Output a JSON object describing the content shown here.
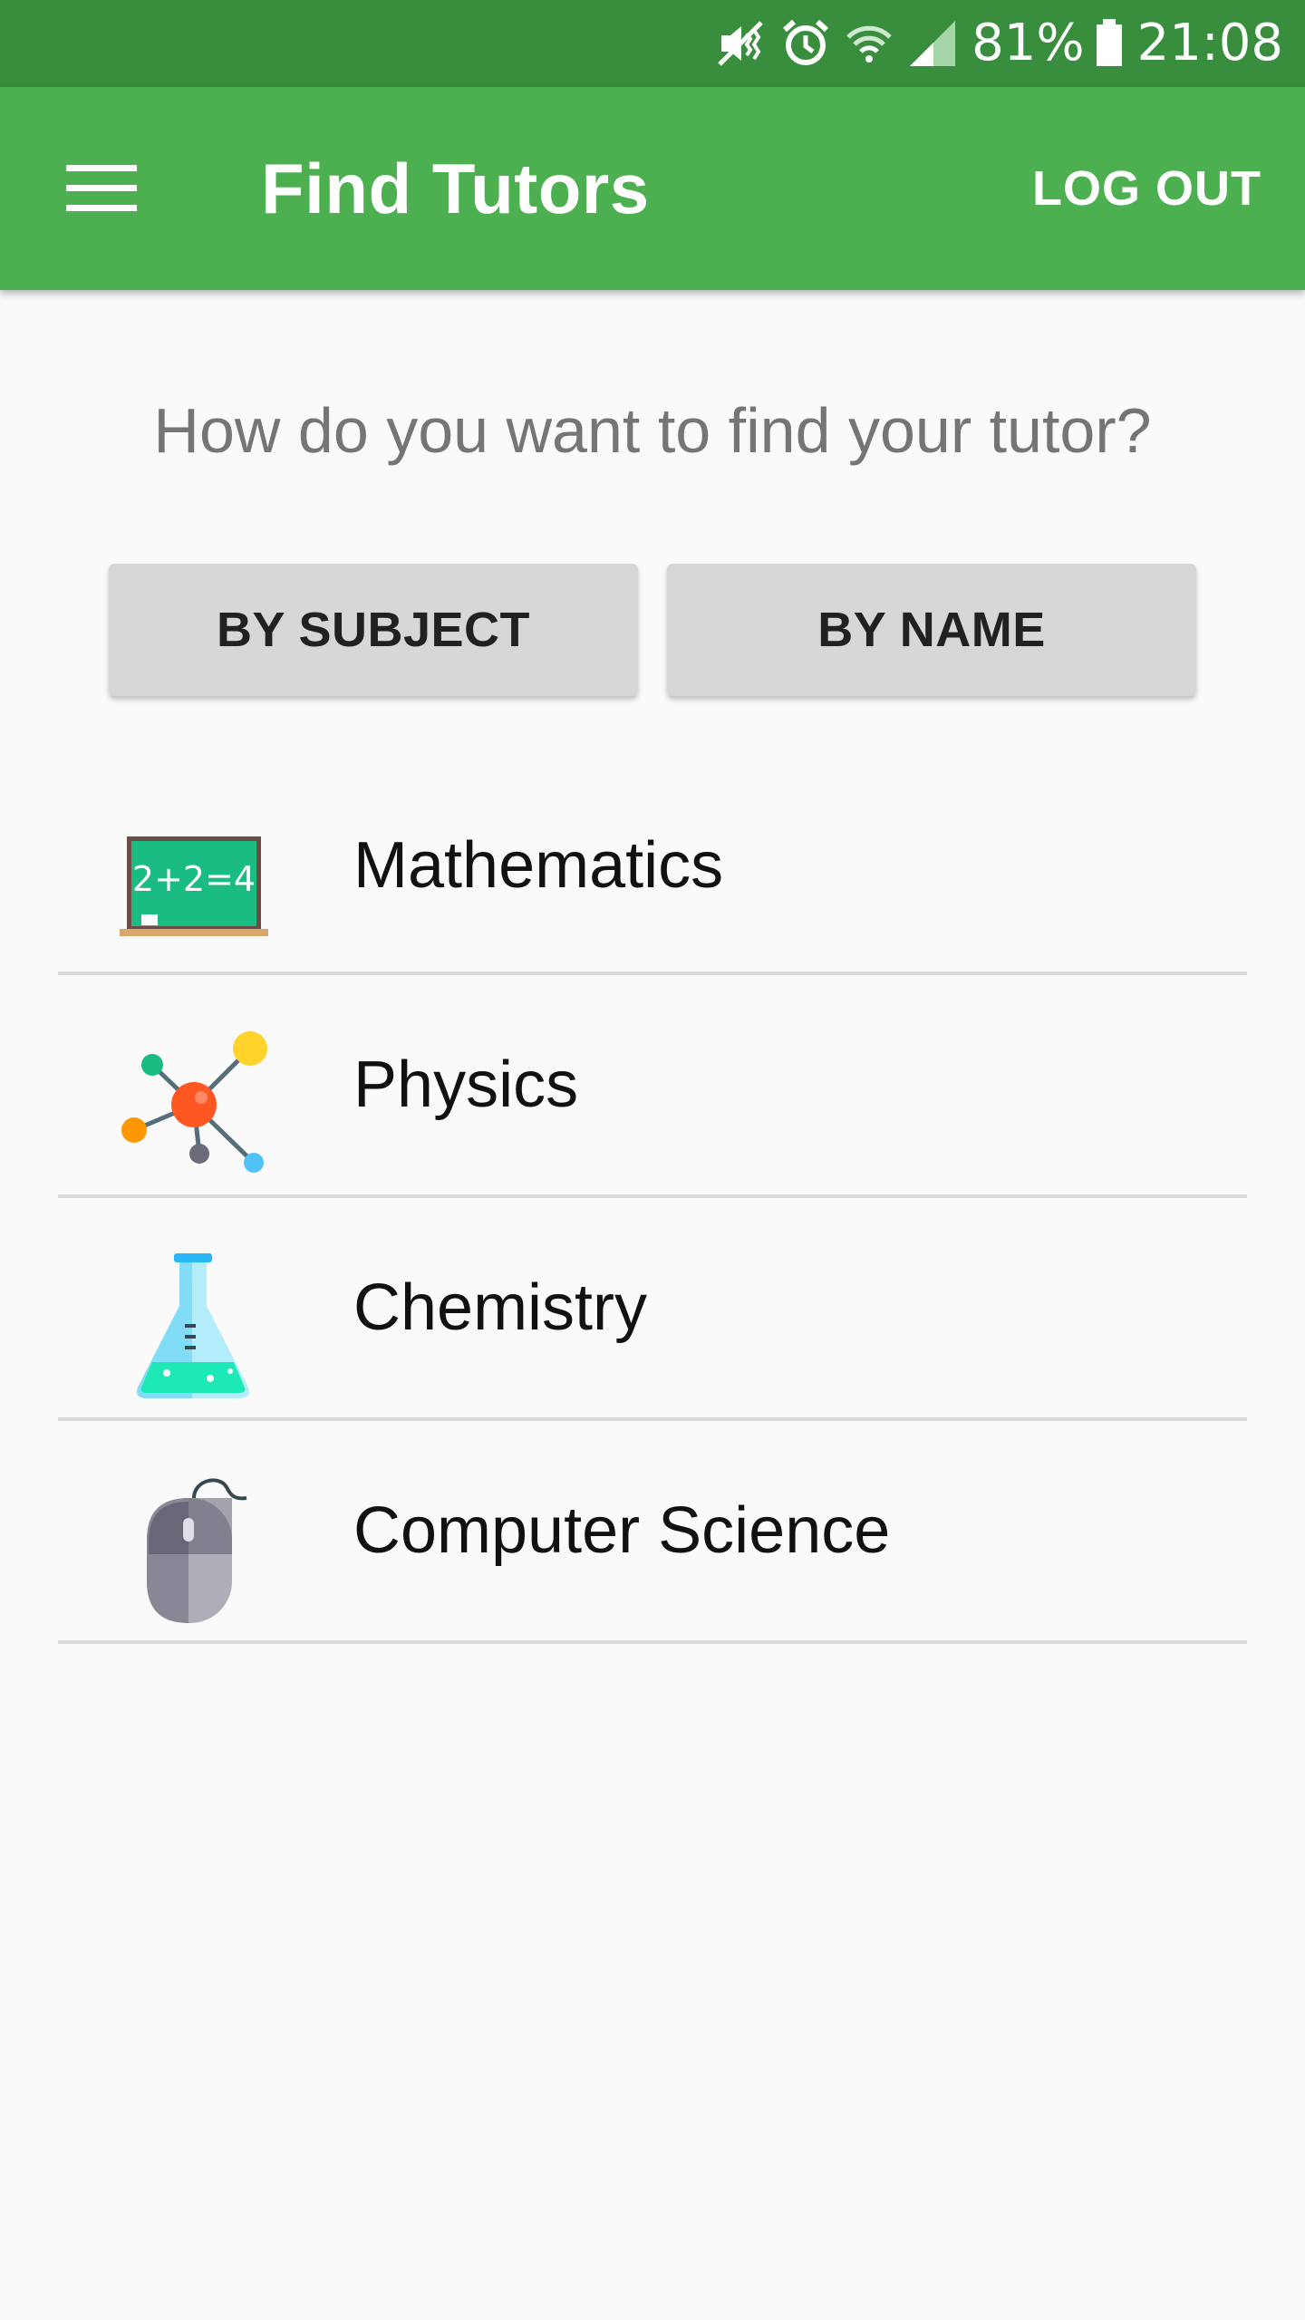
{
  "status_bar": {
    "battery_percent": "81%",
    "time": "21:08",
    "icons": [
      "mute-icon",
      "alarm-icon",
      "wifi-icon",
      "signal-icon",
      "battery-icon"
    ]
  },
  "app_bar": {
    "title": "Find Tutors",
    "logout_label": "LOG OUT",
    "menu_icon": "hamburger-menu-icon"
  },
  "search": {
    "question": "How do you want to find your tutor?",
    "by_subject_label": "BY SUBJECT",
    "by_name_label": "BY NAME"
  },
  "subjects": [
    {
      "label": "Mathematics",
      "icon": "chalkboard-icon",
      "board_text": "2+2=4"
    },
    {
      "label": "Physics",
      "icon": "molecule-icon"
    },
    {
      "label": "Chemistry",
      "icon": "flask-icon"
    },
    {
      "label": "Computer Science",
      "icon": "computer-mouse-icon"
    }
  ],
  "colors": {
    "status_bar": "#388e3c",
    "app_bar": "#4caf50",
    "background": "#fafafa",
    "button": "#d6d7d7",
    "divider": "#dcdcdc"
  }
}
